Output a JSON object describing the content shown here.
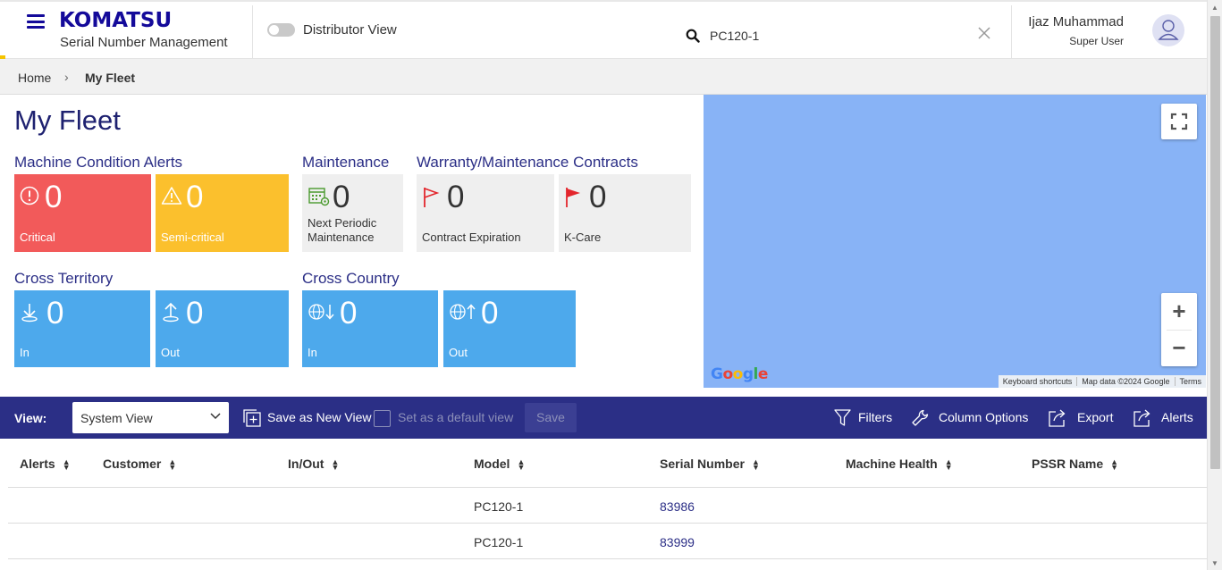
{
  "header": {
    "brand": "KOMATSU",
    "app_name": "Serial Number Management",
    "distributor_toggle_label": "Distributor View",
    "search_value": "PC120-1",
    "user_name": "Ijaz Muhammad",
    "user_role": "Super User"
  },
  "breadcrumb": {
    "home": "Home",
    "current": "My Fleet"
  },
  "page": {
    "title": "My Fleet"
  },
  "sections": {
    "machine_condition": {
      "label": "Machine Condition Alerts",
      "tiles": [
        {
          "count": "0",
          "label": "Critical",
          "icon": "alert-circle-icon",
          "color": "#f25a5a"
        },
        {
          "count": "0",
          "label": "Semi-critical",
          "icon": "warning-triangle-icon",
          "color": "#fbc02d"
        }
      ]
    },
    "maintenance": {
      "label": "Maintenance",
      "tiles": [
        {
          "count": "0",
          "label": "Next Periodic Maintenance",
          "icon": "calendar-gear-icon"
        }
      ]
    },
    "contracts": {
      "label": "Warranty/Maintenance Contracts",
      "tiles": [
        {
          "count": "0",
          "label": "Contract Expiration",
          "icon": "flag-outline-icon"
        },
        {
          "count": "0",
          "label": "K-Care",
          "icon": "flag-filled-icon"
        }
      ]
    },
    "cross_territory": {
      "label": "Cross Territory",
      "tiles": [
        {
          "count": "0",
          "label": "In",
          "icon": "arrow-down-in-icon"
        },
        {
          "count": "0",
          "label": "Out",
          "icon": "arrow-up-out-icon"
        }
      ]
    },
    "cross_country": {
      "label": "Cross Country",
      "tiles": [
        {
          "count": "0",
          "label": "In",
          "icon": "globe-arrow-down-icon"
        },
        {
          "count": "0",
          "label": "Out",
          "icon": "globe-arrow-up-icon"
        }
      ]
    }
  },
  "map": {
    "logo": "Google",
    "shortcuts": "Keyboard shortcuts",
    "data": "Map data ©2024 Google",
    "terms": "Terms",
    "zoom_in": "+",
    "zoom_out": "−"
  },
  "toolbar": {
    "view_label": "View:",
    "view_value": "System View",
    "save_as_new_view": "Save as New View",
    "default_view": "Set as a default view",
    "save": "Save",
    "filters": "Filters",
    "column_options": "Column Options",
    "export": "Export",
    "alerts": "Alerts"
  },
  "table": {
    "columns": [
      "Alerts",
      "Customer",
      "In/Out",
      "Model",
      "Serial Number",
      "Machine Health",
      "PSSR Name"
    ],
    "rows": [
      {
        "alerts": "",
        "customer": "",
        "inout": "",
        "model": "PC120-1",
        "serial": "83986",
        "health": "",
        "pssr": ""
      },
      {
        "alerts": "",
        "customer": "",
        "inout": "",
        "model": "PC120-1",
        "serial": "83999",
        "health": "",
        "pssr": ""
      }
    ]
  },
  "colors": {
    "brand_blue": "#140a9a",
    "toolbar_navy": "#2b2f86",
    "critical_red": "#f25a5a",
    "semi_critical_yellow": "#fbc02d",
    "cross_blue": "#4da9ec",
    "map_water": "#88b3f6"
  }
}
